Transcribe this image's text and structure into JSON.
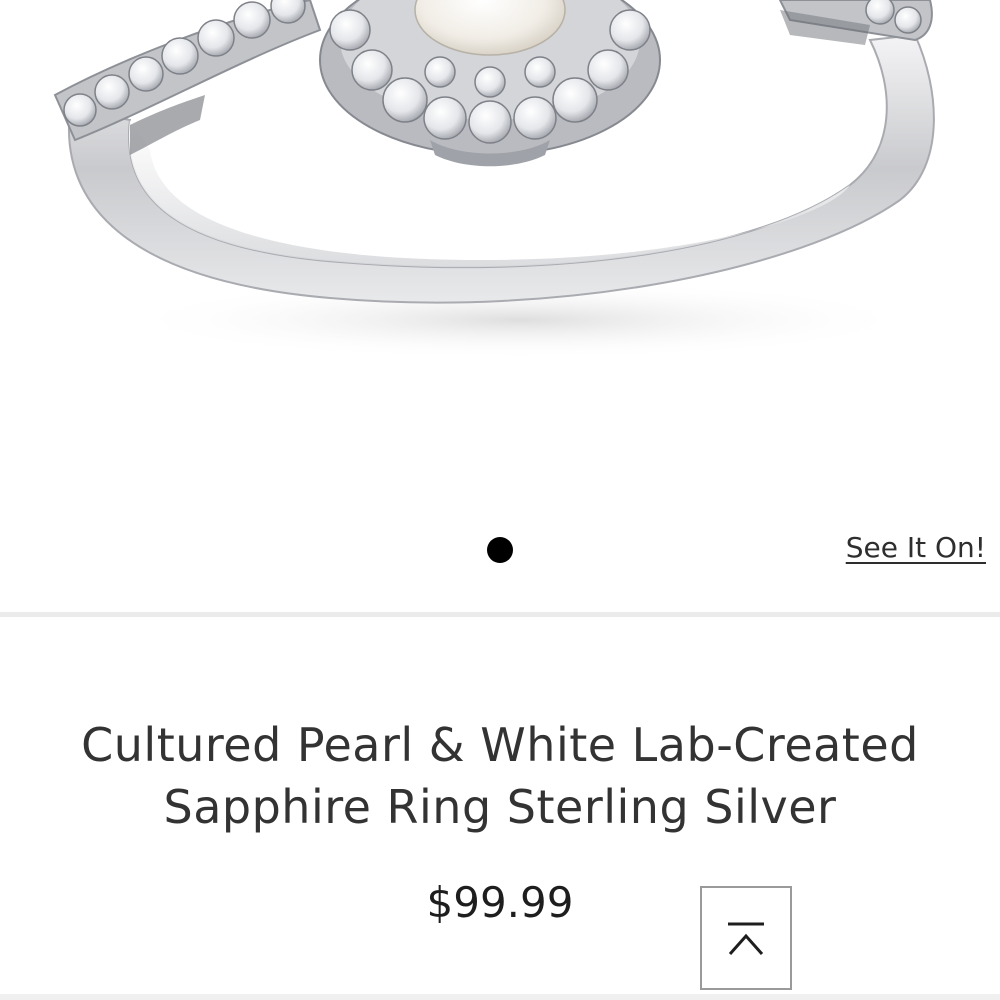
{
  "product": {
    "image_alt": "Cultured Pearl & White Lab-Created Sapphire Ring Sterling Silver",
    "carousel": {
      "slide_count": 1,
      "active_index": 0
    },
    "see_it_on_label": "See It On!",
    "title_line1": "Cultured Pearl & White Lab-Created",
    "title_line2": "Sapphire Ring Sterling Silver",
    "price": "$99.99"
  },
  "controls": {
    "back_to_top_icon": "chevron-up-to-top-icon"
  },
  "colors": {
    "background": "#ffffff",
    "text": "#333333",
    "divider": "#ebebeb",
    "dot_active": "#000000",
    "button_border": "#9a9a9a"
  }
}
